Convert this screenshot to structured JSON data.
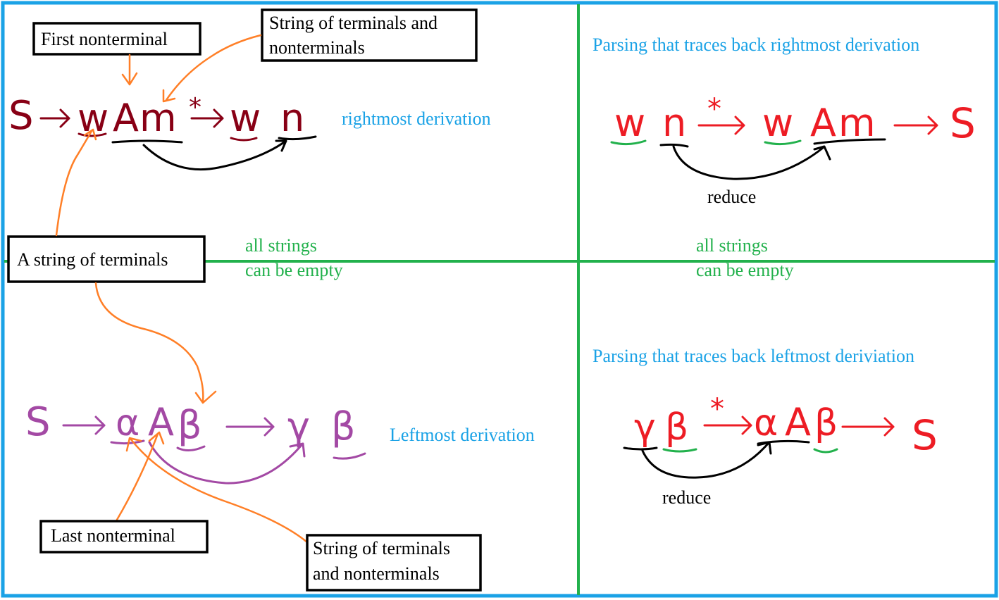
{
  "colors": {
    "frame_blue": "#1aa2e6",
    "grid_green": "#22b14c",
    "label_blue": "#1aa2e6",
    "note_green": "#22b14c",
    "dark_red": "#880015",
    "bright_red": "#ed1c24",
    "purple": "#a349a4",
    "orange": "#ff7f27",
    "black": "#000000"
  },
  "top_left": {
    "callout_first_nonterminal": "First nonterminal",
    "callout_string_line1": "String of terminals and",
    "callout_string_line2": "nonterminals",
    "callout_terminals": "A string of terminals",
    "derivation": {
      "s": "S",
      "w": "w",
      "a": "A",
      "m": "m",
      "star": "*",
      "w2": "w",
      "n": "n"
    },
    "caption": "rightmost derivation",
    "note_line1": "all strings",
    "note_line2": "can be empty"
  },
  "top_right": {
    "title": "Parsing that traces back rightmost derivation",
    "derivation": {
      "w": "w",
      "n": "n",
      "star": "*",
      "w2": "w",
      "a": "A",
      "m": "m",
      "s": "S"
    },
    "reduce": "reduce",
    "note_line1": "all strings",
    "note_line2": "can be empty"
  },
  "bottom_left": {
    "derivation": {
      "s": "S",
      "alpha": "α",
      "a": "A",
      "beta": "β",
      "gamma": "γ",
      "beta2": "β"
    },
    "caption": "Leftmost derivation",
    "callout_last_nonterminal": "Last nonterminal",
    "callout_string_line1": "String of terminals",
    "callout_string_line2": "and nonterminals"
  },
  "bottom_right": {
    "title": "Parsing that traces back leftmost deriviation",
    "derivation": {
      "gamma": "γ",
      "beta": "β",
      "star": "*",
      "alpha": "α",
      "a": "A",
      "beta2": "β",
      "s": "S"
    },
    "reduce": "reduce"
  }
}
